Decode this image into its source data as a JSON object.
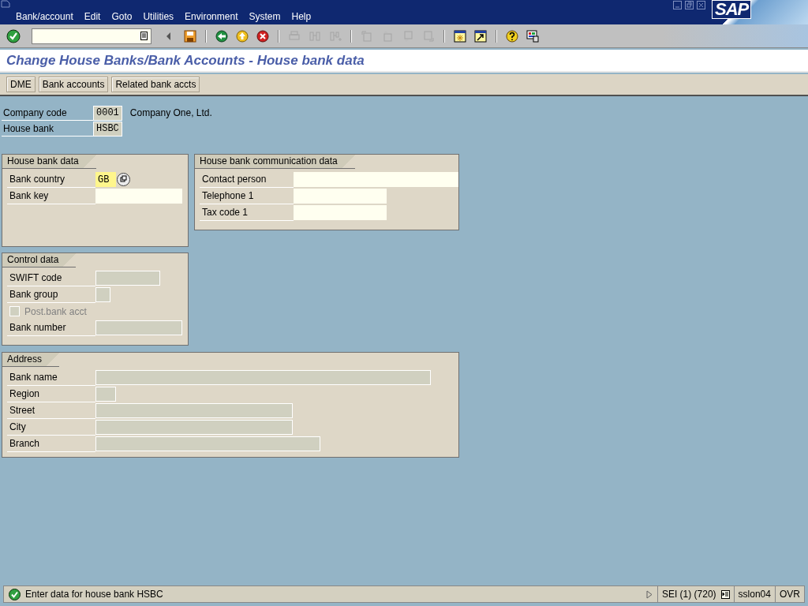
{
  "menu_bar": {
    "items": [
      "Bank/account",
      "Edit",
      "Goto",
      "Utilities",
      "Environment",
      "System",
      "Help"
    ],
    "logo": "SAP"
  },
  "toolbar": {
    "groups": [
      [
        {
          "kind": "back-triangle",
          "disabled": false
        },
        {
          "kind": "save",
          "disabled": false
        }
      ],
      [
        {
          "kind": "back",
          "disabled": false
        },
        {
          "kind": "exit",
          "disabled": false
        },
        {
          "kind": "cancel",
          "disabled": false
        }
      ],
      [
        {
          "kind": "print",
          "disabled": true
        },
        {
          "kind": "find",
          "disabled": true
        },
        {
          "kind": "find-next",
          "disabled": true
        }
      ],
      [
        {
          "kind": "first-page",
          "disabled": true
        },
        {
          "kind": "previous-page",
          "disabled": true
        },
        {
          "kind": "next-page",
          "disabled": true
        },
        {
          "kind": "last-page",
          "disabled": true
        }
      ],
      [
        {
          "kind": "new-session",
          "disabled": false
        },
        {
          "kind": "shortcut",
          "disabled": false
        }
      ],
      [
        {
          "kind": "help",
          "disabled": false
        },
        {
          "kind": "layout",
          "disabled": false
        }
      ]
    ]
  },
  "title": "Change House Banks/Bank Accounts - House bank data",
  "application_toolbar": {
    "buttons": [
      "DME",
      "Bank accounts",
      "Related bank accts"
    ]
  },
  "header": {
    "fields": [
      {
        "label": "Company code",
        "value": "0001",
        "description": "Company One, Ltd."
      },
      {
        "label": "House bank",
        "value": "HSBC"
      }
    ]
  },
  "groups": [
    {
      "title": "House bank data",
      "rows": [
        {
          "kind": "input",
          "label": "Bank country",
          "value": "GB",
          "focused": true,
          "disabled": false,
          "help_button": true
        },
        {
          "kind": "input",
          "label": "Bank key",
          "value": "",
          "focused": false,
          "disabled": false,
          "help_button": false
        }
      ]
    },
    {
      "title": "House bank communication data",
      "rows": [
        {
          "kind": "input",
          "label": "Contact person",
          "value": "",
          "focused": false,
          "disabled": false,
          "help_button": false
        },
        {
          "kind": "input",
          "label": "Telephone 1",
          "value": "",
          "focused": false,
          "disabled": false,
          "help_button": false
        },
        {
          "kind": "input",
          "label": "Tax code 1",
          "value": "",
          "focused": false,
          "disabled": false,
          "help_button": false
        }
      ]
    },
    {
      "title": "Control data",
      "rows": [
        {
          "kind": "input",
          "label": "SWIFT code",
          "value": "",
          "focused": false,
          "disabled": true,
          "help_button": false
        },
        {
          "kind": "input",
          "label": "Bank group",
          "value": "",
          "focused": false,
          "disabled": true,
          "help_button": false
        },
        {
          "kind": "checkbox",
          "label": "Post.bank acct",
          "checked": false,
          "disabled": true
        },
        {
          "kind": "input",
          "label": "Bank number",
          "value": "",
          "focused": false,
          "disabled": true,
          "help_button": false
        }
      ]
    },
    {
      "title": "Address",
      "rows": [
        {
          "kind": "input",
          "label": "Bank name",
          "value": "",
          "focused": false,
          "disabled": true,
          "help_button": false
        },
        {
          "kind": "input",
          "label": "Region",
          "value": "",
          "focused": false,
          "disabled": true,
          "help_button": false
        },
        {
          "kind": "input",
          "label": "Street",
          "value": "",
          "focused": false,
          "disabled": true,
          "help_button": false
        },
        {
          "kind": "input",
          "label": "City",
          "value": "",
          "focused": false,
          "disabled": true,
          "help_button": false
        },
        {
          "kind": "input",
          "label": "Branch",
          "value": "",
          "focused": false,
          "disabled": true,
          "help_button": false
        }
      ]
    }
  ],
  "status_bar": {
    "message": "Enter data for house bank HSBC",
    "segments": [
      "SEI (1) (720)",
      "sslon04",
      "OVR"
    ]
  }
}
